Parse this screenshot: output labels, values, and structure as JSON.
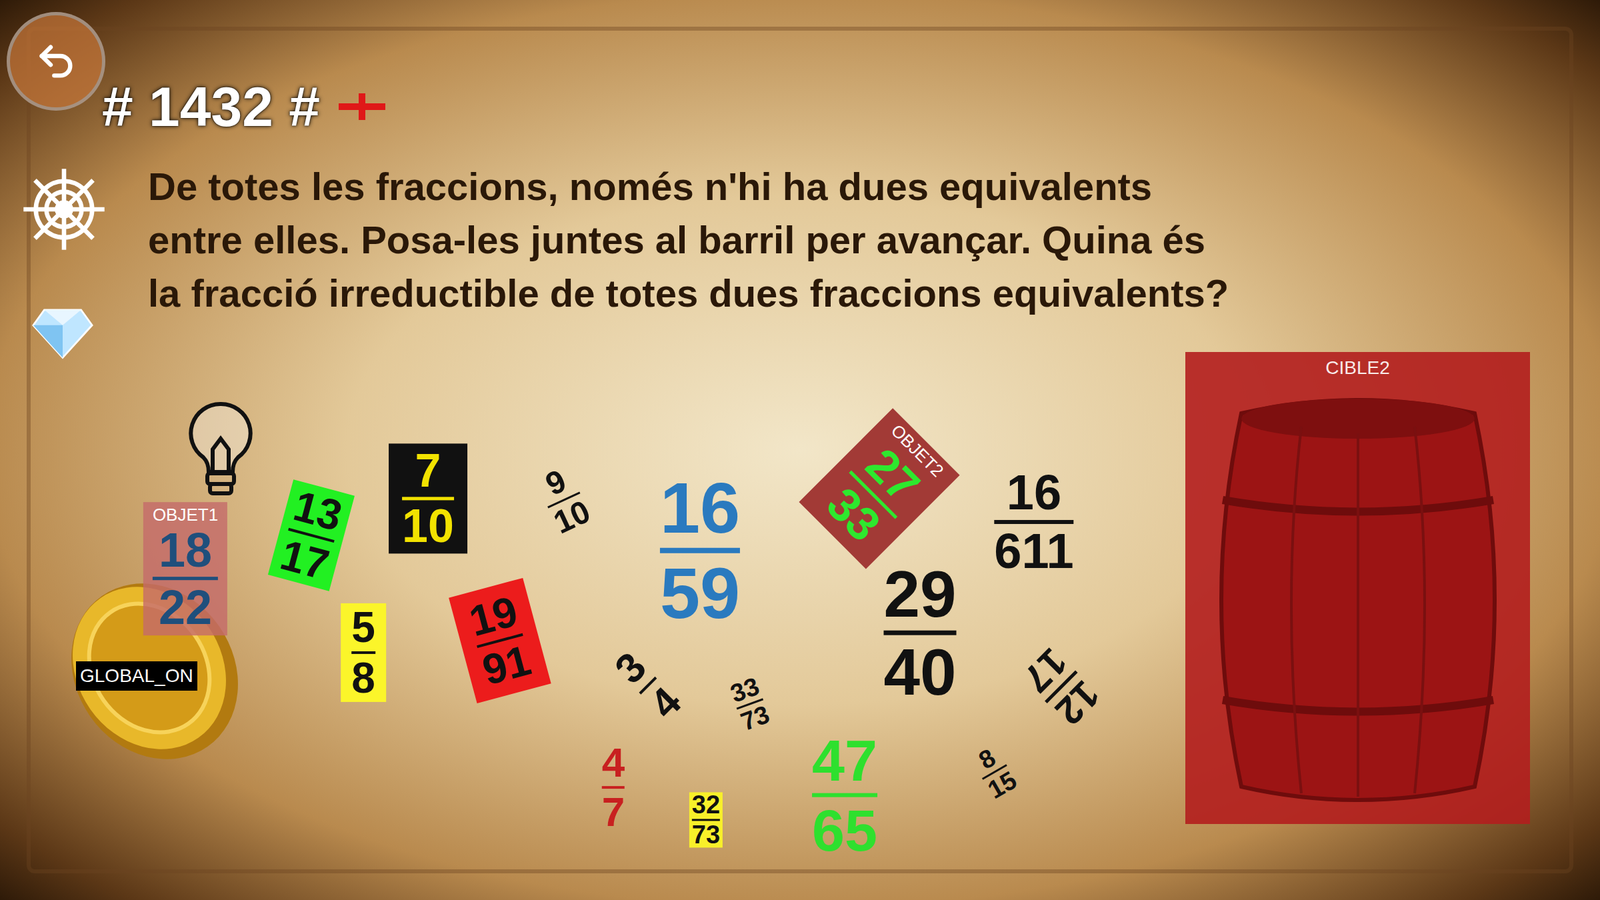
{
  "header": {
    "title": "# 1432 #"
  },
  "question": {
    "lines": [
      "De totes les fraccions, només n'hi ha dues equivalents",
      "entre elles. Posa-les juntes al barril per avançar. Quina és",
      "la fracció irreductible de totes dues fraccions equivalents?"
    ]
  },
  "fractions": [
    {
      "numerator": "18",
      "denominator": "22",
      "color": "#1f4f7c",
      "background": "#c46a6acc",
      "label": "OBJET1"
    },
    {
      "numerator": "13",
      "denominator": "17",
      "color": "#111111",
      "background": "#22f022",
      "label": ""
    },
    {
      "numerator": "7",
      "denominator": "10",
      "color": "#f2e200",
      "background": "#111111",
      "label": ""
    },
    {
      "numerator": "9",
      "denominator": "10",
      "color": "#111111",
      "background": "",
      "label": ""
    },
    {
      "numerator": "16",
      "denominator": "59",
      "color": "#2a7abf",
      "background": "",
      "label": ""
    },
    {
      "numerator": "27",
      "denominator": "33",
      "color": "#2ee82e",
      "background": "#a23a36",
      "label": "OBJET2"
    },
    {
      "numerator": "16",
      "denominator": "611",
      "color": "#111111",
      "background": "",
      "label": ""
    },
    {
      "numerator": "29",
      "denominator": "40",
      "color": "#111111",
      "background": "",
      "label": ""
    },
    {
      "numerator": "5",
      "denominator": "8",
      "color": "#111111",
      "background": "#fbf52a",
      "label": ""
    },
    {
      "numerator": "19",
      "denominator": "91",
      "color": "#111111",
      "background": "#ec1c1c",
      "label": ""
    },
    {
      "numerator": "3",
      "denominator": "4",
      "color": "#111111",
      "background": "",
      "label": ""
    },
    {
      "numerator": "33",
      "denominator": "73",
      "color": "#111111",
      "background": "",
      "label": ""
    },
    {
      "numerator": "12",
      "denominator": "17",
      "color": "#111111",
      "background": "",
      "label": ""
    },
    {
      "numerator": "4",
      "denominator": "7",
      "color": "#c82020",
      "background": "",
      "label": ""
    },
    {
      "numerator": "32",
      "denominator": "73",
      "color": "#111111",
      "background": "#f8f02a",
      "label": ""
    },
    {
      "numerator": "47",
      "denominator": "65",
      "color": "#2ee02e",
      "background": "",
      "label": ""
    },
    {
      "numerator": "8",
      "denominator": "15",
      "color": "#111111",
      "background": "",
      "label": ""
    }
  ],
  "coin": {
    "label": "GLOBAL_ON"
  },
  "barrel": {
    "label": "CIBLE2"
  }
}
